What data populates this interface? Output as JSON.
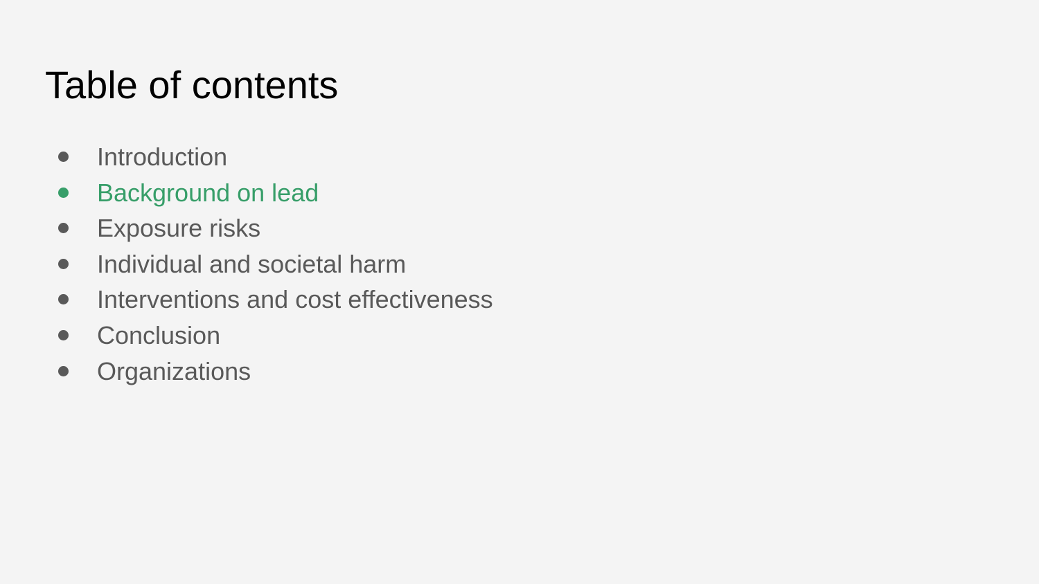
{
  "slide": {
    "title": "Table of contents",
    "items": [
      {
        "label": "Introduction",
        "active": false
      },
      {
        "label": "Background on lead",
        "active": true
      },
      {
        "label": "Exposure risks",
        "active": false
      },
      {
        "label": "Individual and societal harm",
        "active": false
      },
      {
        "label": "Interventions and cost effectiveness",
        "active": false
      },
      {
        "label": "Conclusion",
        "active": false
      },
      {
        "label": "Organizations",
        "active": false
      }
    ]
  },
  "colors": {
    "background": "#f4f4f4",
    "title": "#000000",
    "item_text": "#595959",
    "active_item": "#379e69"
  }
}
